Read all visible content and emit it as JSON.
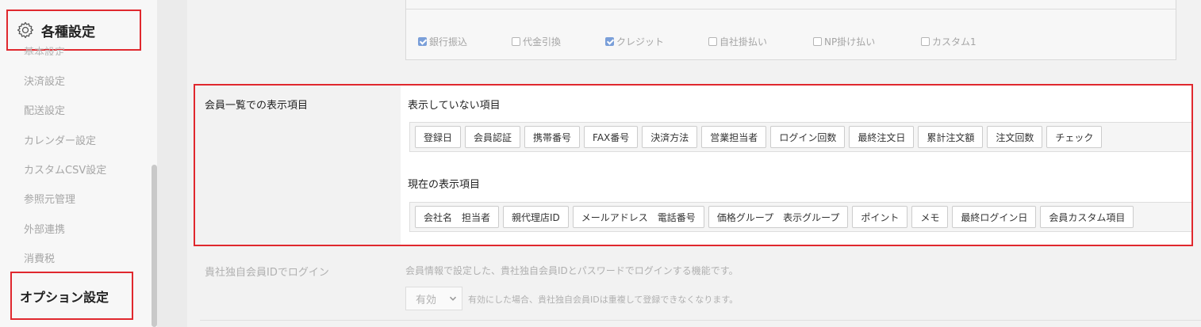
{
  "sidebar": {
    "section_title": "各種設定",
    "clipped_item": "基本設定",
    "items": [
      "決済設定",
      "配送設定",
      "カレンダー設定",
      "カスタムCSV設定",
      "参照元管理",
      "外部連携",
      "消費税"
    ],
    "option_section": "オプション設定"
  },
  "payment_methods": [
    {
      "label": "銀行振込",
      "checked": true
    },
    {
      "label": "代金引換",
      "checked": false
    },
    {
      "label": "クレジット",
      "checked": true
    },
    {
      "label": "自社掛払い",
      "checked": false
    },
    {
      "label": "NP掛け払い",
      "checked": false
    },
    {
      "label": "カスタム1",
      "checked": false
    }
  ],
  "member_list": {
    "label": "会員一覧での表示項目",
    "hidden_title": "表示していない項目",
    "hidden_items": [
      "登録日",
      "会員認証",
      "携帯番号",
      "FAX番号",
      "決済方法",
      "営業担当者",
      "ログイン回数",
      "最終注文日",
      "累計注文額",
      "注文回数",
      "チェック"
    ],
    "shown_title": "現在の表示項目",
    "shown_items": [
      "会社名　担当者",
      "親代理店ID",
      "メールアドレス　電話番号",
      "価格グループ　表示グループ",
      "ポイント",
      "メモ",
      "最終ログイン日",
      "会員カスタム項目"
    ]
  },
  "login": {
    "label": "貴社独自会員IDでログイン",
    "description": "会員情報で設定した、貴社独自会員IDとパスワードでログインする機能です。",
    "select_value": "有効",
    "note": "有効にした場合、貴社独自会員IDは重複して登録できなくなります。"
  },
  "colors": {
    "highlight": "#e0282e",
    "checkbox_on": "#7a9fd9"
  }
}
